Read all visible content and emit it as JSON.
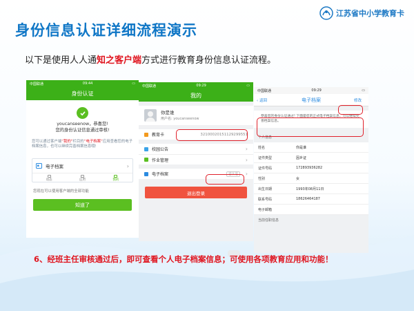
{
  "slide": {
    "title": "身份信息认证详细流程演示",
    "brand": "江苏省中小学教育卡",
    "intro_before": "以下是使用人人通",
    "intro_highlight": "知之客户端",
    "intro_after": "方式进行教育身份信息认证流程。",
    "caption": "6、经班主任审核通过后，即可查看个人电子档案信息；可使用各项教育应用和功能！"
  },
  "colors": {
    "title_blue": "#0f76c6",
    "app_green": "#3cb018",
    "button_green": "#5bbf21",
    "logout_red": "#f0533f",
    "highlight_red": "#e0202a"
  },
  "phone1": {
    "status_carrier": "中国联通",
    "status_time": "09:44",
    "nav_title": "身份认证",
    "success_line1": "youcanseenow，恭喜您!",
    "success_line2": "您的身份认证信息通过审核!",
    "desc_part1": "您可以通过客户端",
    "desc_red1": "“我的”",
    "desc_part2": "栏目的",
    "desc_red2": "“电子档案”",
    "desc_part3": "应用查看您的电子档案信息，也可以继续完善档案信息哦!",
    "archive_label": "电子档案",
    "tabs": [
      "动态",
      "应用",
      "我的"
    ],
    "hint": "您现在可以使用客户端的全部功能",
    "button": "知道了"
  },
  "phone2": {
    "status_carrier": "中国联通",
    "status_time": "09:29",
    "nav_title": "我的",
    "user_name": "你是谁",
    "user_account": "用户名: youcanseenow",
    "card_label": "教育卡",
    "card_number": "32100020151129299551",
    "menu": [
      {
        "label": "校园公告"
      },
      {
        "label": "作业管理"
      }
    ],
    "archive_label": "电子档案",
    "archive_tag": "已认证",
    "logout": "退出登录"
  },
  "phone3": {
    "status_carrier": "中国联通",
    "status_time": "09:29",
    "back": "返回",
    "nav_title": "电子档案",
    "edit": "修改",
    "notice": "恭喜您的身份认证通过! 下面是您的正式电子档案信息，可以继续完善档案信息。",
    "section_personal": "个人信息",
    "fields": [
      {
        "k": "姓名",
        "v": "你是谁"
      },
      {
        "k": "证件类型",
        "v": "因乡证"
      },
      {
        "k": "证件号码",
        "v": "172893936282"
      },
      {
        "k": "性别",
        "v": "女"
      },
      {
        "k": "出生日期",
        "v": "1993年08月11日"
      },
      {
        "k": "联系号码",
        "v": "18626464187"
      },
      {
        "k": "电子邮箱",
        "v": ""
      }
    ],
    "section_school": "当前任职信息"
  }
}
